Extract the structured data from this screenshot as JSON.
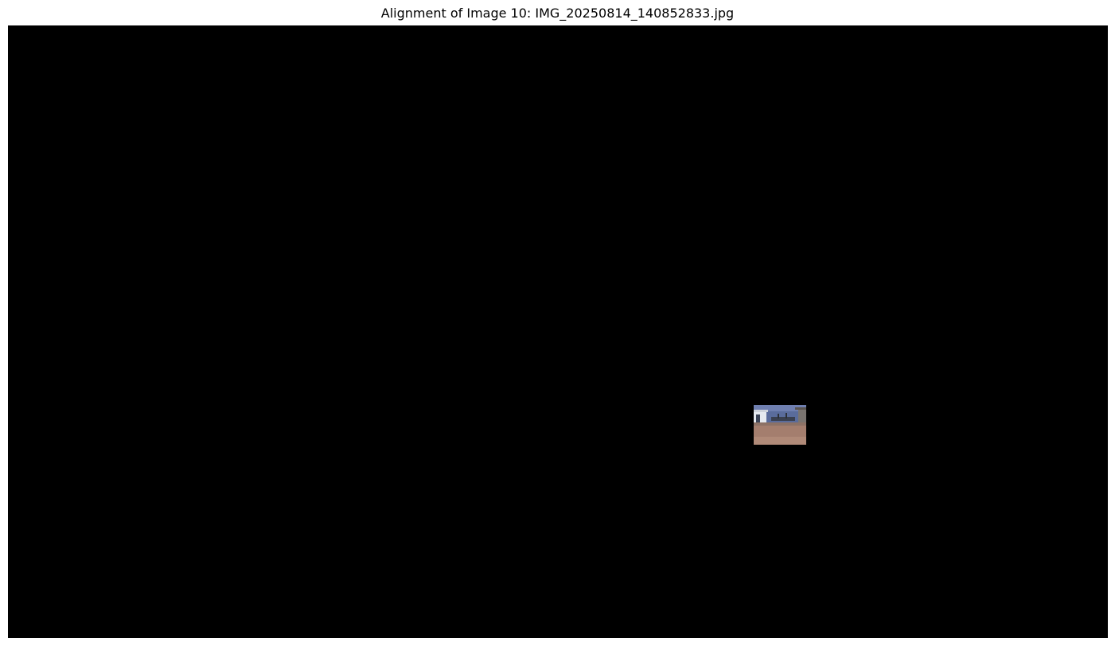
{
  "figure": {
    "title": "Alignment of Image 10: IMG_20250814_140852833.jpg"
  },
  "colors": {
    "canvas_background": "#000000",
    "page_background": "#ffffff",
    "sky": "#5b6a9a",
    "ground": "#a57d6f",
    "building": "#e8ecf2"
  }
}
